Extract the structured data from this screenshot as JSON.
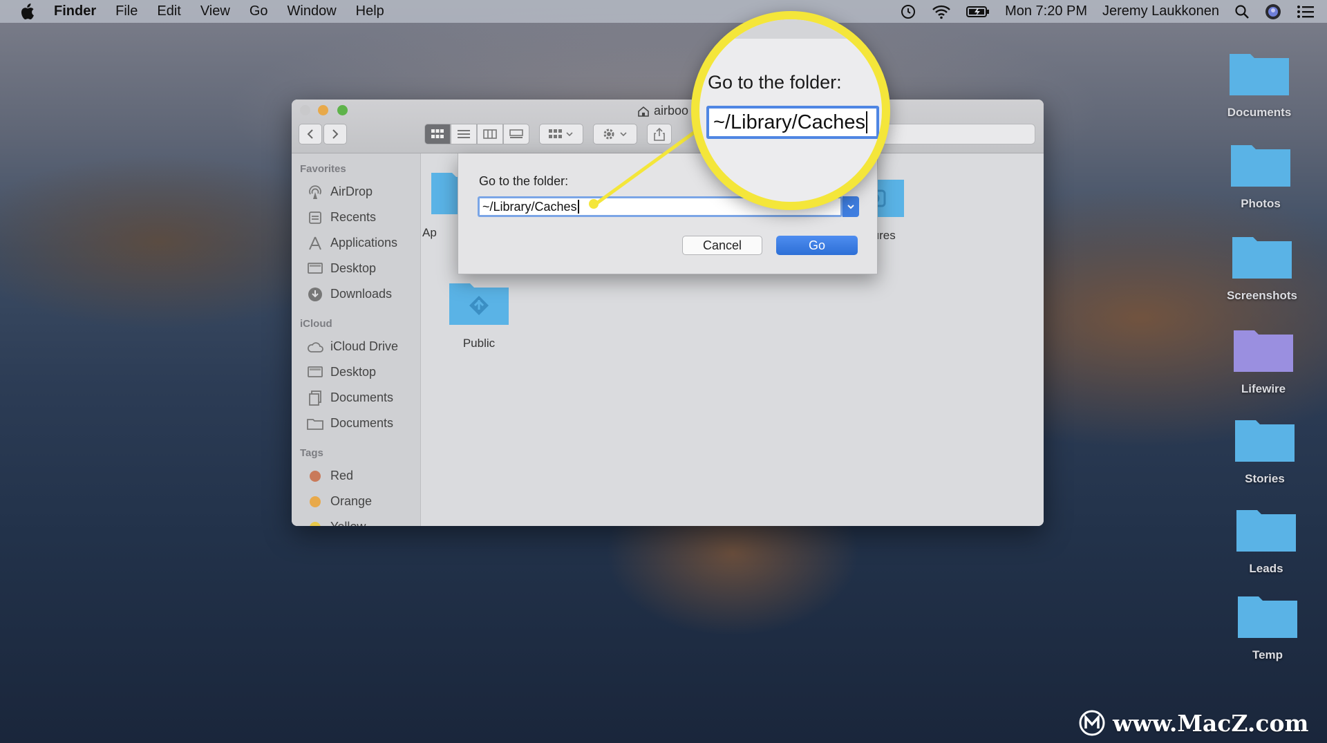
{
  "menubar": {
    "items": [
      "Finder",
      "File",
      "Edit",
      "View",
      "Go",
      "Window",
      "Help"
    ],
    "clock": "Mon 7:20 PM",
    "user": "Jeremy Laukkonen",
    "status_icons": [
      "time-machine-icon",
      "wifi-icon",
      "battery-icon",
      "spotlight-search-icon",
      "siri-icon",
      "notification-center-icon"
    ]
  },
  "finder": {
    "title": "airboo",
    "sidebar": {
      "favorites_heading": "Favorites",
      "favorites": [
        {
          "label": "AirDrop",
          "icon": "airdrop-icon"
        },
        {
          "label": "Recents",
          "icon": "recents-icon"
        },
        {
          "label": "Applications",
          "icon": "applications-icon"
        },
        {
          "label": "Desktop",
          "icon": "desktop-icon"
        },
        {
          "label": "Downloads",
          "icon": "downloads-icon"
        }
      ],
      "icloud_heading": "iCloud",
      "icloud": [
        {
          "label": "iCloud Drive",
          "icon": "cloud-icon"
        },
        {
          "label": "Desktop",
          "icon": "desktop-icon"
        },
        {
          "label": "Documents",
          "icon": "documents-icon"
        },
        {
          "label": "Documents",
          "icon": "folder-icon"
        }
      ],
      "tags_heading": "Tags",
      "tags": [
        {
          "label": "Red",
          "color": "#c97a5a"
        },
        {
          "label": "Orange",
          "color": "#e8a94a"
        },
        {
          "label": "Yellow",
          "color": "#e8c84a"
        }
      ]
    },
    "content": {
      "folders": [
        {
          "label": "Ap"
        },
        {
          "label": "Pictures"
        },
        {
          "label": "Public"
        }
      ]
    }
  },
  "go_dialog": {
    "prompt": "Go to the folder:",
    "path_value": "~/Library/Caches",
    "cancel_label": "Cancel",
    "go_label": "Go"
  },
  "magnifier": {
    "prompt": "Go to the folder:",
    "path_value": "~/Library/Caches"
  },
  "desktop": {
    "icons": [
      "Documents",
      "Photos",
      "Screenshots",
      "Lifewire",
      "Stories",
      "Leads",
      "Temp"
    ]
  },
  "watermark": {
    "text": "www.MacZ.com"
  },
  "colors": {
    "folder_blue": "#5ab3e6",
    "folder_purple": "#9a8fe0",
    "accent_blue": "#3f7ee0",
    "highlight_yellow": "#f4e63a"
  }
}
